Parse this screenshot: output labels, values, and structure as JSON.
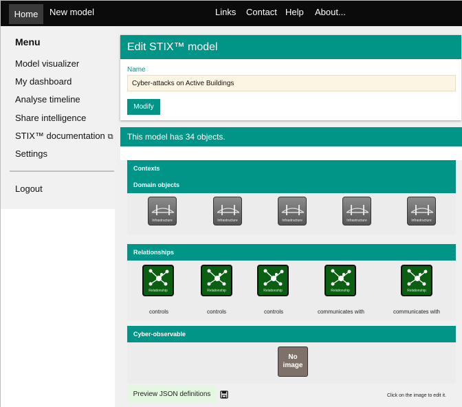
{
  "nav": {
    "home": "Home",
    "new_model": "New model",
    "links": "Links",
    "contact": "Contact",
    "help": "Help",
    "about": "About..."
  },
  "sidebar": {
    "title": "Menu",
    "items": [
      {
        "label": "Model visualizer"
      },
      {
        "label": "My dashboard"
      },
      {
        "label": "Analyse timeline"
      },
      {
        "label": "Share intelligence"
      },
      {
        "label": "STIX™ documentation",
        "icon": "external-link-icon"
      },
      {
        "label": "Settings"
      }
    ],
    "logout": "Logout"
  },
  "edit_card": {
    "title": "Edit STIX™ model",
    "name_label": "Name",
    "name_value": "Cyber-attacks on Active Buildings",
    "modify_label": "Modify"
  },
  "summary": "This model has 34 objects.",
  "sections": {
    "contexts": "Contexts",
    "domain_objects": "Domain objects",
    "relationships": "Relationships",
    "cyber_observable": "Cyber-observable"
  },
  "domain_objects": [
    {
      "caption": "Infrastructure"
    },
    {
      "caption": "Infrastructure"
    },
    {
      "caption": "Infrastructure"
    },
    {
      "caption": "Infrastructure"
    },
    {
      "caption": "Infrastructure"
    }
  ],
  "relationships": [
    {
      "caption": "Relationship",
      "label": "controls"
    },
    {
      "caption": "Relationship",
      "label": "controls"
    },
    {
      "caption": "Relationship",
      "label": "controls"
    },
    {
      "caption": "Relationship",
      "label": "communicates with"
    },
    {
      "caption": "Relationship",
      "label": "communicates with"
    }
  ],
  "observable": {
    "no_image": "No image"
  },
  "footer": {
    "preview_label": "Preview JSON definitions",
    "hint": "Click on the image to edit it."
  },
  "colors": {
    "accent": "#009586",
    "topbar": "#0b0b0b",
    "relationship_icon": "#0a5f13",
    "input_bg": "#fcf5e3"
  }
}
